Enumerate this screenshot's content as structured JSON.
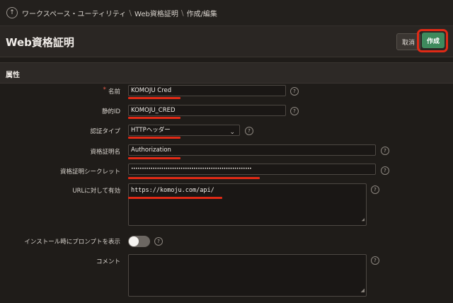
{
  "breadcrumb": {
    "items": [
      "ワークスペース・ユーティリティ",
      "Web資格証明",
      "作成/編集"
    ]
  },
  "header": {
    "title": "Web資格証明",
    "cancel_label": "取消",
    "create_label": "作成"
  },
  "region": {
    "title": "属性"
  },
  "form": {
    "name": {
      "label": "名前",
      "value": "KOMOJU Cred"
    },
    "static_id": {
      "label": "静的ID",
      "value": "KOMOJU_CRED"
    },
    "auth_type": {
      "label": "認証タイプ",
      "value": "HTTPヘッダー"
    },
    "credential_name": {
      "label": "資格証明名",
      "value": "Authorization"
    },
    "credential_secret": {
      "label": "資格証明シークレット",
      "value": "••••••••••••••••••••••••••••••••••••••••••••••••••••••••"
    },
    "valid_urls": {
      "label": "URLに対して有効",
      "value": "https://komoju.com/api/"
    },
    "prompt_on_install": {
      "label": "インストール時にプロンプトを表示",
      "value": false
    },
    "comment": {
      "label": "コメント",
      "value": ""
    }
  },
  "colors": {
    "accent": "#3e8a5d",
    "annotation": "#e02a16",
    "background": "#1f1c19"
  }
}
